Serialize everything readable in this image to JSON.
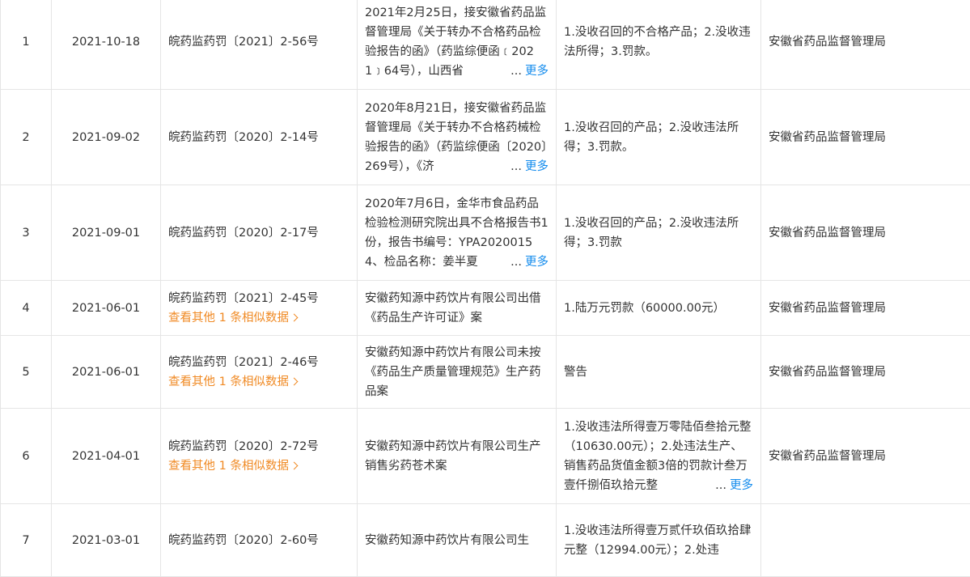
{
  "rows": [
    {
      "no": "1",
      "date": "2021-10-18",
      "doc_no": "皖药监药罚〔2021〕2-56号",
      "case": "2021年2月25日，接安徽省药品监督管理局《关于转办不合格药品检验报告的函》（药监综便函﹝2021﹞64号），山西省",
      "case_truncated": true,
      "penalty": "1.没收召回的不合格产品；2.没收违法所得；3.罚款。",
      "authority": "安徽省药品监督管理局"
    },
    {
      "no": "2",
      "date": "2021-09-02",
      "doc_no": "皖药监药罚〔2020〕2-14号",
      "case": "2020年8月21日，接安徽省药品监督管理局《关于转办不合格药械检验报告的函》（药监综便函〔2020〕269号），《济",
      "case_truncated": true,
      "penalty": "1.没收召回的产品；2.没收违法所得；3.罚款。",
      "authority": "安徽省药品监督管理局"
    },
    {
      "no": "3",
      "date": "2021-09-01",
      "doc_no": "皖药监药罚〔2020〕2-17号",
      "case": "2020年7月6日，金华市食品药品检验检测研究院出具不合格报告书1份，报告书编号：YPA20200154、检品名称：姜半夏",
      "case_truncated": true,
      "penalty": "1.没收召回的产品；2.没收违法所得；3.罚款",
      "authority": "安徽省药品监督管理局"
    },
    {
      "no": "4",
      "date": "2021-06-01",
      "doc_no": "皖药监药罚〔2021〕2-45号",
      "similar": "查看其他 1 条相似数据",
      "case": "安徽药知源中药饮片有限公司出借《药品生产许可证》案",
      "penalty": "1.陆万元罚款（60000.00元）",
      "authority": "安徽省药品监督管理局"
    },
    {
      "no": "5",
      "date": "2021-06-01",
      "doc_no": "皖药监药罚〔2021〕2-46号",
      "similar": "查看其他 1 条相似数据",
      "case": "安徽药知源中药饮片有限公司未按《药品生产质量管理规范》生产药品案",
      "penalty": "警告",
      "authority": "安徽省药品监督管理局"
    },
    {
      "no": "6",
      "date": "2021-04-01",
      "doc_no": "皖药监药罚〔2020〕2-72号",
      "similar": "查看其他 1 条相似数据",
      "case": "安徽药知源中药饮片有限公司生产销售劣药苍术案",
      "penalty": "1.没收违法所得壹万零陆佰叁拾元整（10630.00元）；2.处违法生产、销售药品货值金额3倍的罚款计叁万壹仟捌佰玖拾元整",
      "penalty_truncated": true,
      "authority": "安徽省药品监督管理局"
    },
    {
      "no": "7",
      "date": "2021-03-01",
      "doc_no": "皖药监药罚〔2020〕2-60号",
      "case": "安徽药知源中药饮片有限公司生",
      "penalty": "1.没收违法所得壹万贰仟玖佰玖拾肆元整（12994.00元）；2.处违",
      "authority": ""
    }
  ],
  "more_label": "更多",
  "ellipsis": "...",
  "colors": {
    "link": "#128bed",
    "similar": "#f08a24",
    "border": "#e5e5e5"
  }
}
